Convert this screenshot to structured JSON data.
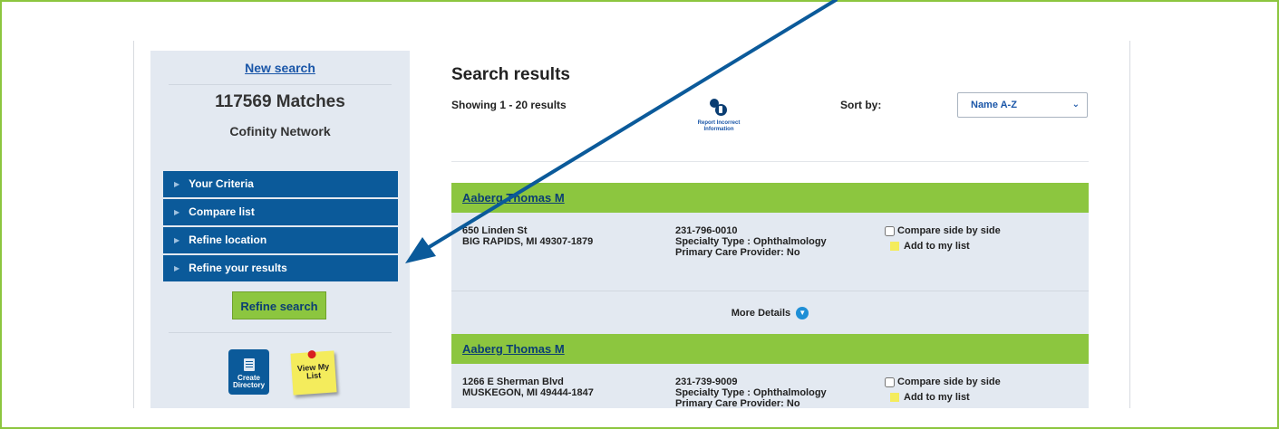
{
  "sidebar": {
    "new_search": "New search",
    "matches": "117569 Matches",
    "network": "Cofinity Network",
    "accordion": [
      "Your Criteria",
      "Compare list",
      "Refine location",
      "Refine your results"
    ],
    "refine_button": "Refine search",
    "create_directory": "Create Directory",
    "view_my_list": "View My List"
  },
  "main": {
    "title": "Search results",
    "showing": "Showing 1  -  20  results",
    "report_incorrect": "Report Incorrect Information",
    "sort_label": "Sort by:",
    "sort_value": "Name A-Z",
    "results": [
      {
        "name": "Aaberg Thomas M",
        "address1": "650 Linden St",
        "address2": "BIG RAPIDS, MI 49307-1879",
        "phone": "231-796-0010",
        "specialty": "Specialty Type : Ophthalmology",
        "pcp": "Primary Care Provider: No",
        "compare": "Compare side by side",
        "add": "Add to my list",
        "more": "More Details"
      },
      {
        "name": "Aaberg Thomas M",
        "address1": "1266 E Sherman Blvd",
        "address2": "MUSKEGON, MI 49444-1847",
        "phone": "231-739-9009",
        "specialty": "Specialty Type : Ophthalmology",
        "pcp": "Primary Care Provider: No",
        "compare": "Compare side by side",
        "add": "Add to my list"
      }
    ]
  },
  "colors": {
    "accent_green": "#8cc63f",
    "nav_blue": "#0b5a9a",
    "panel_bg": "#e3e9f1",
    "link_blue": "#1a56a8",
    "arrow_blue": "#0b5a9a"
  }
}
